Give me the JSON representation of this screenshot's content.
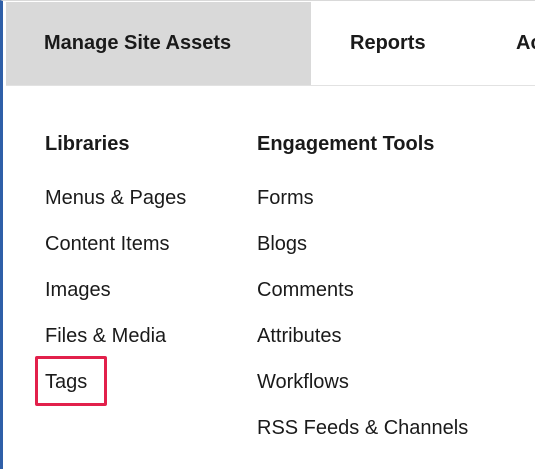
{
  "tabs": [
    {
      "label": "Manage Site Assets",
      "active": true
    },
    {
      "label": "Reports",
      "active": false
    },
    {
      "label": "Ac",
      "active": false
    }
  ],
  "libraries": {
    "heading": "Libraries",
    "items": [
      "Menus & Pages",
      "Content Items",
      "Images",
      "Files & Media",
      "Tags"
    ]
  },
  "engagement": {
    "heading": "Engagement Tools",
    "items": [
      "Forms",
      "Blogs",
      "Comments",
      "Attributes",
      "Workflows",
      "RSS Feeds & Channels"
    ]
  },
  "colors": {
    "active_tab_bg": "#d9d9d9",
    "highlight": "#e2204b",
    "left_border": "#2f5fa8"
  }
}
